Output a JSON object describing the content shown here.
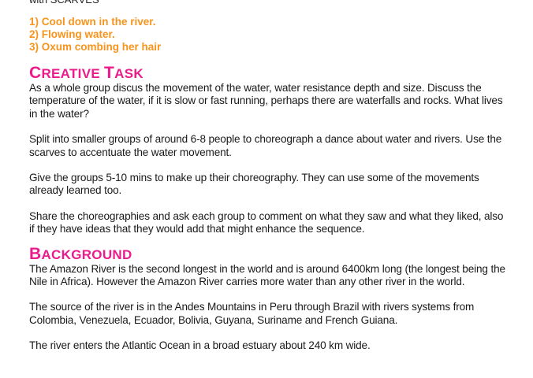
{
  "intro_fragment": "with SCARVES",
  "steps": [
    "1) Cool down in the river.",
    "2) Flowing water.",
    "3) Oxum combing her hair"
  ],
  "creative_task": {
    "heading_first": "C",
    "heading_rest": "REATIVE ",
    "heading_first2": "T",
    "heading_rest2": "ASK",
    "heading": "Creative Task",
    "paragraphs": [
      "As a whole group discus the movement of the water, water resistance depth and size.  Discuss the temperature of the water, if it is slow or fast running, perhaps there are waterfalls and rocks. What lives in the water?",
      "Split into smaller groups of around 6-8 people to choreograph a dance about water and rivers. Use the scarves to accentuate the water movement.",
      "Give the groups 5-10 mins to make up their choreography.  They can use some of the movements already learned too.",
      "Share the choreographies and ask each group to comment on what they saw and what they liked, also if they have ideas that they would add that might enhance the sequence."
    ]
  },
  "background": {
    "heading_first": "B",
    "heading_rest": "ACKGROUND",
    "heading": "Background",
    "paragraphs": [
      "The Amazon River is the second longest in the world and is around 6400km long (the longest being the Nile in Africa).  However the Amazon River carries more water than any other river in the world.",
      "The source of the river is in the Andes Mountains in Peru through Brazil with rivers systems from Colombia, Venezuela, Ecuador, Bolivia, Guyana, Suriname and French Guiana.",
      "The river enters the Atlantic Ocean in a broad estuary about 240 km wide."
    ]
  },
  "colors": {
    "heading": "#ec1b8c",
    "steps": "#f7941d",
    "body_text": "#1a1a1a"
  }
}
